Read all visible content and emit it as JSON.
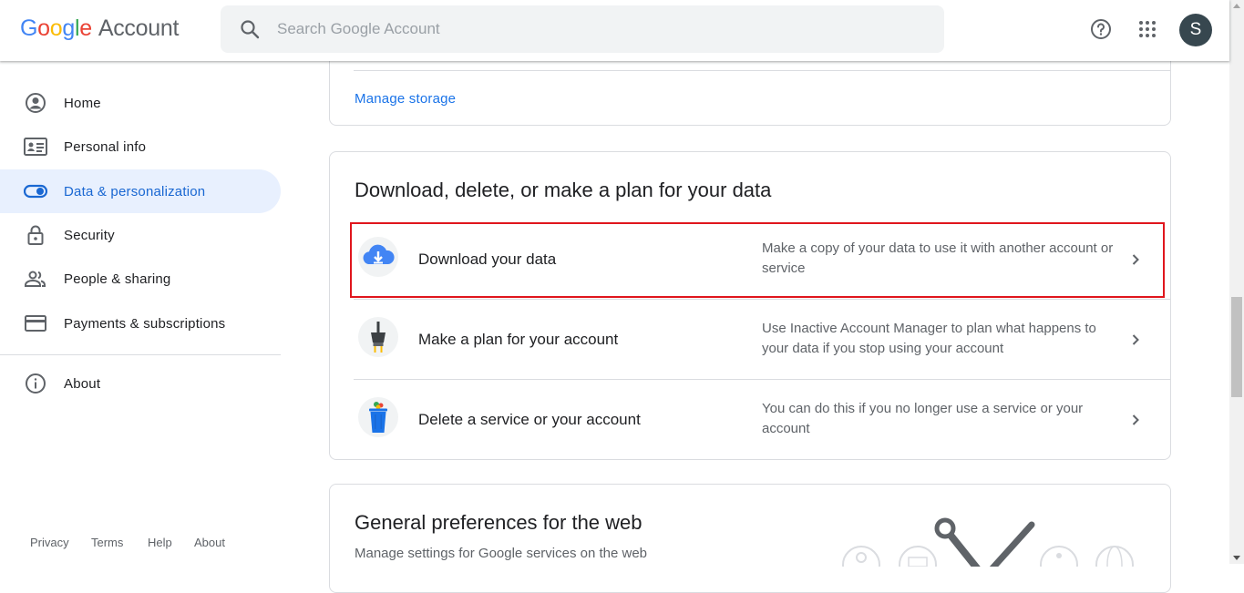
{
  "header": {
    "logo_letters": [
      "G",
      "o",
      "o",
      "g",
      "l",
      "e"
    ],
    "logo_product": "Account",
    "search_placeholder": "Search Google Account",
    "avatar_letter": "S"
  },
  "sidebar": {
    "items": [
      {
        "label": "Home",
        "icon": "account-circle-icon"
      },
      {
        "label": "Personal info",
        "icon": "id-card-icon"
      },
      {
        "label": "Data & personalization",
        "icon": "toggle-icon",
        "active": true
      },
      {
        "label": "Security",
        "icon": "lock-icon"
      },
      {
        "label": "People & sharing",
        "icon": "people-icon"
      },
      {
        "label": "Payments & subscriptions",
        "icon": "credit-card-icon"
      },
      {
        "label": "About",
        "icon": "info-icon"
      }
    ],
    "footer": [
      "Privacy",
      "Terms",
      "Help",
      "About"
    ]
  },
  "storage_card": {
    "link": "Manage storage"
  },
  "data_card": {
    "title": "Download, delete, or make a plan for your data",
    "rows": [
      {
        "title": "Download your data",
        "description": "Make a copy of your data to use it with another account or service",
        "icon": "cloud-download-icon"
      },
      {
        "title": "Make a plan for your account",
        "description": "Use Inactive Account Manager to plan what happens to your data if you stop using your account",
        "icon": "plug-icon"
      },
      {
        "title": "Delete a service or your account",
        "description": "You can do this if you no longer use a service or your account",
        "icon": "trash-bin-icon"
      }
    ]
  },
  "prefs_card": {
    "title": "General preferences for the web",
    "subtitle": "Manage settings for Google services on the web"
  },
  "colors": {
    "accent": "#1a73e8",
    "active_bg": "#e8f0fe",
    "highlight": "#e0161d"
  }
}
